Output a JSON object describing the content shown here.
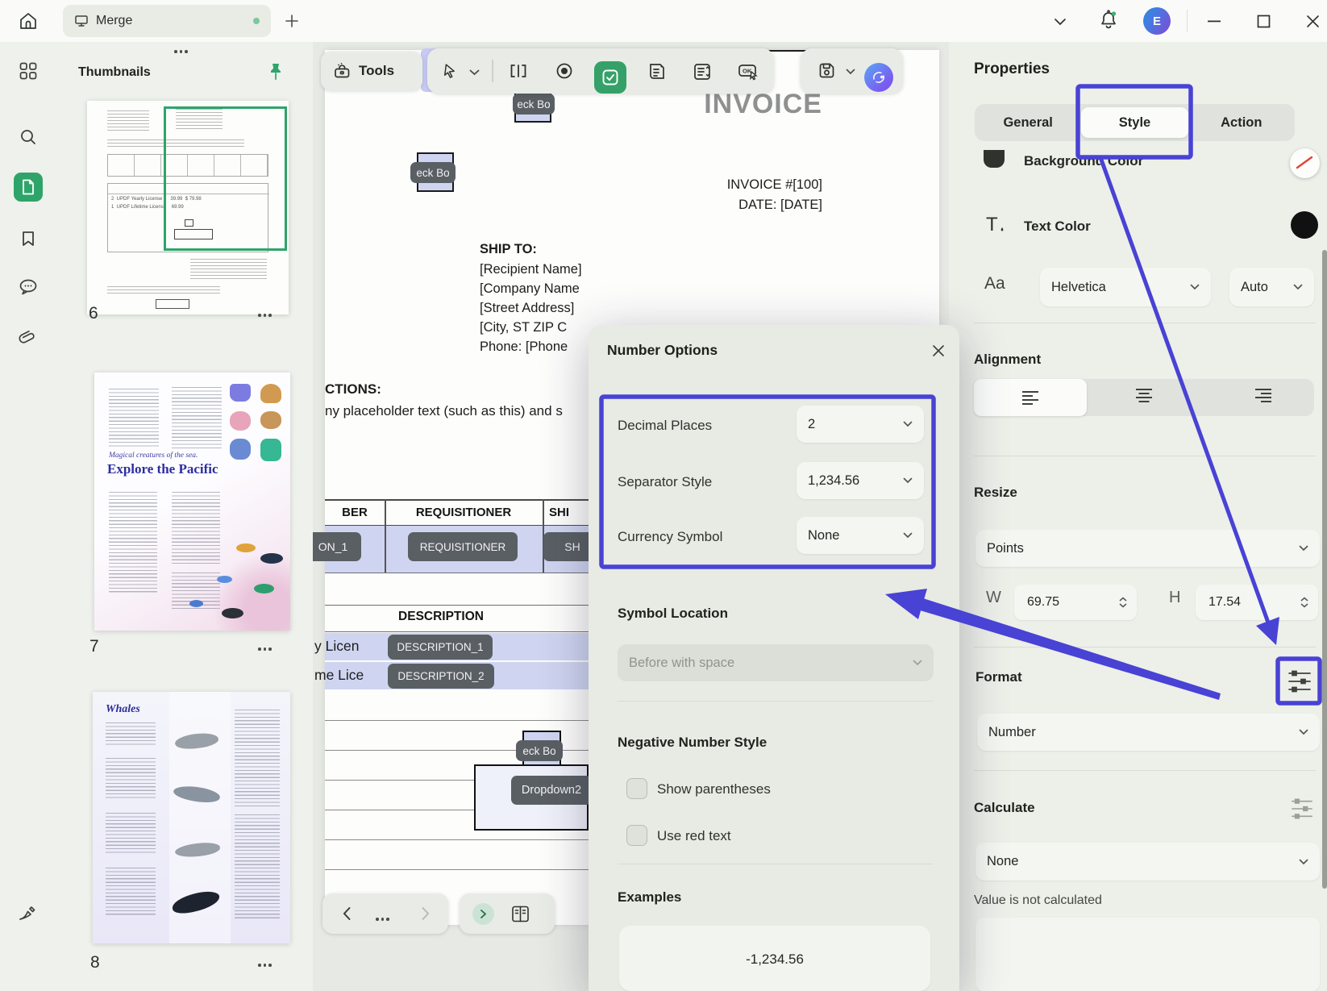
{
  "titlebar": {
    "tab_label": "Merge"
  },
  "user": {
    "avatar_initial": "E"
  },
  "thumbnails_panel": {
    "title": "Thumbnails",
    "pages": [
      {
        "label": "6"
      },
      {
        "label": "7",
        "subheading": "Magical creatures of the sea.",
        "heading": "Explore the Pacific"
      },
      {
        "label": "8",
        "heading": "Whales"
      }
    ]
  },
  "toolbar": {
    "tools_label": "Tools",
    "ok_icon_label": "OK"
  },
  "document": {
    "invoice_title": "INVOICE",
    "invoice_number": "INVOICE #[100]",
    "invoice_date": "DATE: [DATE]",
    "ship_to_heading": "SHIP TO:",
    "ship_to_lines": [
      "[Recipient Name]",
      "[Company Name",
      "[Street Address]",
      "[City, ST ZIP C",
      "Phone: [Phone"
    ],
    "instructions_heading": "CTIONS:",
    "instructions_line": "ny placeholder text (such as this) and s",
    "table": {
      "col1": "BER",
      "col2": "REQUISITIONER",
      "col3": "SHI"
    },
    "field_tags": {
      "tag1": "ON_1",
      "tag2": "REQUISITIONER",
      "tag3": "SH",
      "checkbox": "eck Bo",
      "dropdown": "Dropdown2",
      "desc1": "DESCRIPTION_1",
      "desc2": "DESCRIPTION_2"
    },
    "description_heading": "DESCRIPTION",
    "row1_text": "y Licen",
    "row2_text": "me Lice",
    "mini_invoice_row1": "2  UPDF Yearly License      39.99  $ 79.98",
    "mini_invoice_row2": "1  UPDF Lifetime License    69.99"
  },
  "dialog": {
    "title": "Number Options",
    "fields": [
      {
        "label": "Decimal Places",
        "value": "2"
      },
      {
        "label": "Separator Style",
        "value": "1,234.56"
      },
      {
        "label": "Currency Symbol",
        "value": "None"
      }
    ],
    "symbol_location_heading": "Symbol Location",
    "symbol_location_value": "Before with space",
    "negative_heading": "Negative Number Style",
    "negative_option1": "Show parentheses",
    "negative_option2": "Use red text",
    "examples_heading": "Examples",
    "example_value": "-1,234.56"
  },
  "properties": {
    "title": "Properties",
    "tabs": [
      {
        "label": "General"
      },
      {
        "label": "Style"
      },
      {
        "label": "Action"
      }
    ],
    "background_color_label": "Background Color",
    "text_color_label": "Text Color",
    "font_icon": "Aa",
    "font_family": "Helvetica",
    "font_size": "Auto",
    "alignment_heading": "Alignment",
    "resize_heading": "Resize",
    "resize_unit": "Points",
    "w_label": "W",
    "w_value": "69.75",
    "h_label": "H",
    "h_value": "17.54",
    "format_heading": "Format",
    "format_value": "Number",
    "calculate_heading": "Calculate",
    "calculate_value": "None",
    "calculate_note": "Value is not calculated"
  },
  "colors": {
    "accent_blue": "#4842d5",
    "brand_green": "#2fa46a",
    "field_lavender": "#cfd5f1",
    "tag_gray": "#5a5f64"
  }
}
